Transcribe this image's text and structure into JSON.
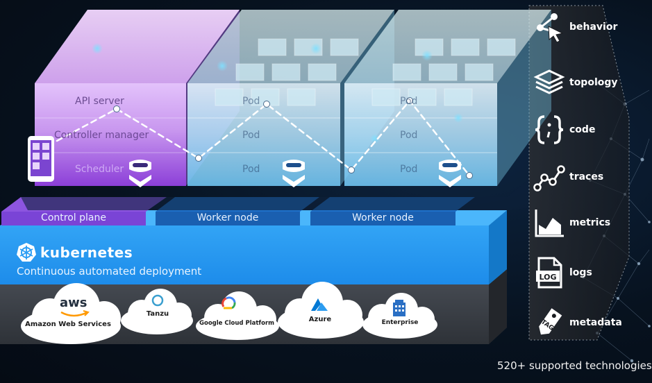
{
  "control_plane": {
    "components": [
      "API server",
      "Controller manager",
      "Scheduler"
    ],
    "band_label": "Control plane"
  },
  "worker_nodes": [
    {
      "pods": [
        "Pod",
        "Pod",
        "Pod"
      ],
      "band_label": "Worker node"
    },
    {
      "pods": [
        "Pod",
        "Pod",
        "Pod"
      ],
      "band_label": "Worker node"
    }
  ],
  "kubernetes": {
    "title": "kubernetes",
    "subtitle": "Continuous automated deployment"
  },
  "clouds": [
    {
      "label": "Amazon Web Services",
      "logo_text": "aws",
      "icon": "aws-logo"
    },
    {
      "label": "Tanzu",
      "icon": "tanzu-logo"
    },
    {
      "label": "Google Cloud Platform",
      "icon": "gcp-logo"
    },
    {
      "label": "Azure",
      "icon": "azure-logo"
    },
    {
      "label": "Enterprise",
      "icon": "building-icon"
    }
  ],
  "observability": [
    {
      "label": "behavior",
      "icon": "cursor-share-icon"
    },
    {
      "label": "topology",
      "icon": "layers-icon"
    },
    {
      "label": "code",
      "icon": "braces-icon"
    },
    {
      "label": "traces",
      "icon": "trace-path-icon"
    },
    {
      "label": "metrics",
      "icon": "area-chart-icon"
    },
    {
      "label": "logs",
      "icon": "log-file-icon"
    },
    {
      "label": "metadata",
      "icon": "tag-icon"
    }
  ],
  "footer": {
    "text": "520+ supported technologies"
  },
  "colors": {
    "control_plane": "#c58cf0",
    "worker": "#a9e3ff",
    "kubernetes_band": "#2a9df4",
    "cloud_band": "#3a3f47"
  }
}
